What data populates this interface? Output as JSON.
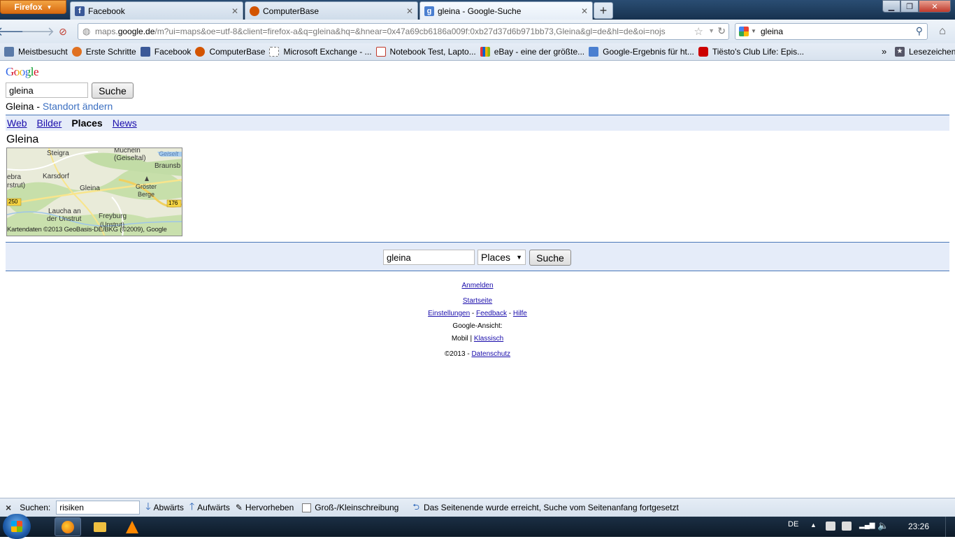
{
  "browser": {
    "app_button": "Firefox",
    "tabs": [
      {
        "label": "Facebook",
        "color": "#3b5998"
      },
      {
        "label": "ComputerBase",
        "color": "#d35400"
      },
      {
        "label": "gleina - Google-Suche",
        "color": "#4a7fd0"
      }
    ],
    "url_prefix": "maps.",
    "url_host": "google.de",
    "url_rest": "/m?ui=maps&oe=utf-8&client=firefox-a&q=gleina&hq=&hnear=0x47a69cb6186a009f:0xb27d37d6b971bb73,Gleina&gl=de&hl=de&oi=nojs",
    "search_value": "gleina",
    "bookmarks": [
      {
        "label": "Meistbesucht",
        "color": "#5a7aa8"
      },
      {
        "label": "Erste Schritte",
        "color": "#e07020"
      },
      {
        "label": "Facebook",
        "color": "#3b5998"
      },
      {
        "label": "ComputerBase",
        "color": "#d35400"
      },
      {
        "label": "Microsoft Exchange - ...",
        "color": "#ffffff"
      },
      {
        "label": "Notebook Test, Lapto...",
        "color": "#c0392b"
      },
      {
        "label": "eBay - eine der größte...",
        "color": "#e5a000"
      },
      {
        "label": "Google-Ergebnis für ht...",
        "color": "#4a7fd0"
      },
      {
        "label": "Tiësto's Club Life: Epis...",
        "color": "#cc0000"
      }
    ],
    "bookmarks_more": "»",
    "lesezeichen": "Lesezeichen"
  },
  "google": {
    "logo": "Google",
    "query": "gleina",
    "search_button": "Suche",
    "location": "Gleina",
    "location_sep": " - ",
    "change_location": "Standort ändern",
    "nav": {
      "web": "Web",
      "bilder": "Bilder",
      "places": "Places",
      "news": "News"
    },
    "result_title": "Gleina",
    "map": {
      "labels": [
        "Steigra",
        "Mücheln (Geiseltal)",
        "Geiselt",
        "Braunsb",
        "ebra",
        "rstrut)",
        "Karsdorf",
        "Gleina",
        "Gröster",
        "Berge",
        "250",
        "176",
        "Laucha an",
        "der Unstrut",
        "Freyburg",
        "(Unstrut)"
      ],
      "copyright": "Kartendaten ©2013 GeoBasis-DE/BKG (©2009), Google"
    },
    "bottom_query": "gleina",
    "bottom_select": "Places",
    "bottom_button": "Suche",
    "footer": {
      "anmelden": "Anmelden",
      "startseite": "Startseite",
      "einstellungen": "Einstellungen",
      "feedback": "Feedback",
      "hilfe": "Hilfe",
      "sep": " - ",
      "ansicht": "Google-Ansicht:",
      "mobil": "Mobil",
      "pipe": " | ",
      "klassisch": "Klassisch",
      "copyright": "©2013 - ",
      "datenschutz": "Datenschutz"
    }
  },
  "findbar": {
    "close": "×",
    "label": "Suchen:",
    "value": "risiken",
    "down": "Abwärts",
    "up": "Aufwärts",
    "highlight": "Hervorheben",
    "case": "Groß-/Kleinschreibung",
    "status": "Das Seitenende wurde erreicht, Suche vom Seitenanfang fortgesetzt"
  },
  "taskbar": {
    "lang": "DE",
    "time": "23:26"
  }
}
